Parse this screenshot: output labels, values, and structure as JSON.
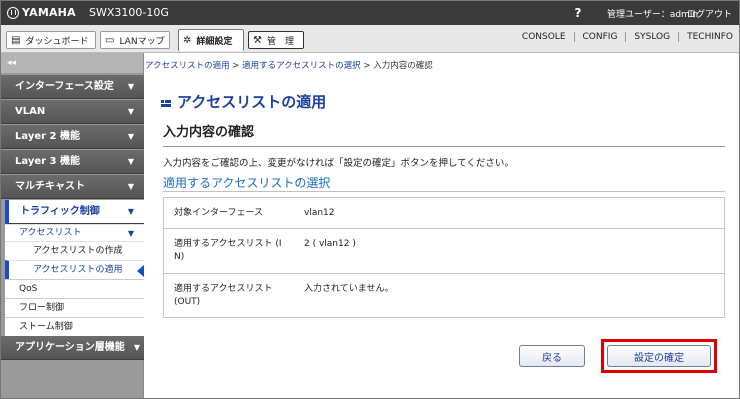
{
  "header": {
    "brand": "YAMAHA",
    "model": "SWX3100-10G",
    "help": "?",
    "user": "管理ユーザー：admin",
    "logout": "ログアウト"
  },
  "toolbar": {
    "dashboard": "ダッシュボード",
    "lanmap": "LANマップ",
    "detail": "詳細設定",
    "manage": "管　理",
    "links": [
      "CONSOLE",
      "CONFIG",
      "SYSLOG",
      "TECHINFO"
    ]
  },
  "sidebar": {
    "collapse": "◂◂",
    "menus": [
      "インターフェース設定",
      "VLAN",
      "Layer 2 機能",
      "Layer 3 機能",
      "マルチキャスト",
      "トラフィック制御",
      "アプリケーション層機能"
    ],
    "sub_acl": "アクセスリスト",
    "acl_create": "アクセスリストの作成",
    "acl_apply": "アクセスリストの適用",
    "qos": "QoS",
    "flow": "フロー制御",
    "storm": "ストーム制御"
  },
  "breadcrumb": {
    "c1": "アクセスリストの適用",
    "sep1": " > ",
    "c2": "適用するアクセスリストの選択",
    "sep2": " > ",
    "c3": "入力内容の確認"
  },
  "main": {
    "title": "アクセスリストの適用",
    "section": "入力内容の確認",
    "description": "入力内容をご確認の上、変更がなければ「設定の確定」ボタンを押してください。",
    "subhead": "適用するアクセスリストの選択",
    "rows": [
      {
        "k1": "対象インターフェース",
        "k2": "",
        "v": "vlan12"
      },
      {
        "k1": "適用するアクセスリスト (I",
        "k2": "N)",
        "v": "2 ( vlan12 )"
      },
      {
        "k1": "適用するアクセスリスト",
        "k2": "(OUT)",
        "v": "入力されていません。"
      }
    ],
    "back_label": "戻る",
    "confirm_label": "設定の確定"
  },
  "colors": {
    "accent": "#1a3fa0",
    "highlight": "#e00000",
    "topbar": "#3a3a3a"
  }
}
